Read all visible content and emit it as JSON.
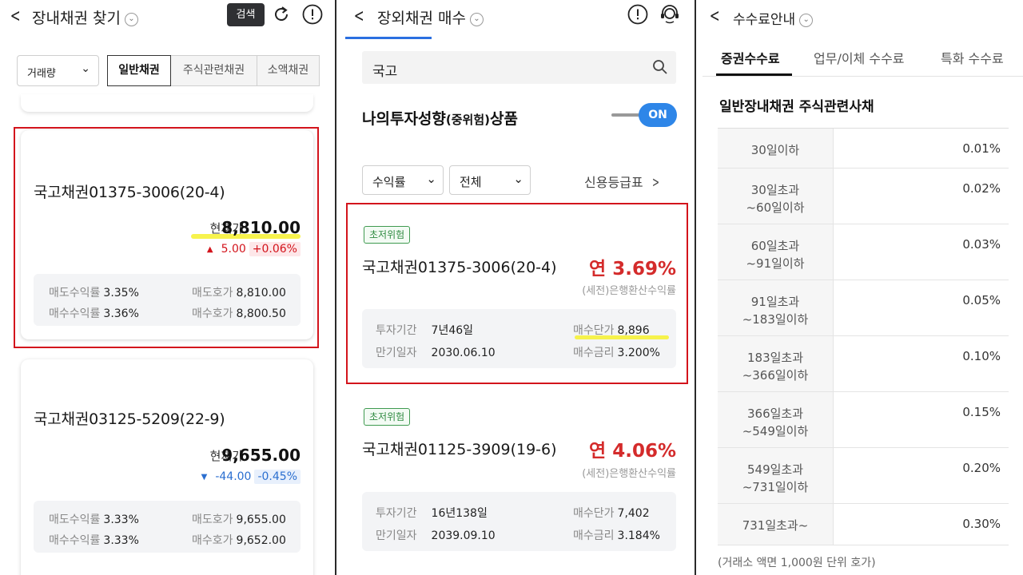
{
  "colors": {
    "accent_blue": "#2e86e8",
    "up_red": "#d3141c",
    "down_blue": "#2b6fd0",
    "risk_green": "#2e8a40",
    "rate_red": "#d42b2b"
  },
  "panel1": {
    "title": "장내채권 찾기",
    "search_label": "검색",
    "sort_select": "거래량",
    "segments": [
      "일반채권",
      "주식관련채권",
      "소액채권"
    ],
    "bonds": [
      {
        "name": "국고채권01375-3006(20-4)",
        "current_label": "현재가",
        "current_value": "8,810.00",
        "change": "5.00",
        "change_pct": "+0.06%",
        "direction": "up",
        "sell_yield_label": "매도수익률",
        "sell_yield": "3.35%",
        "buy_yield_label": "매수수익률",
        "buy_yield": "3.36%",
        "sell_quote_label": "매도호가",
        "sell_quote": "8,810.00",
        "buy_quote_label": "매수호가",
        "buy_quote": "8,800.50"
      },
      {
        "name": "국고채권03125-5209(22-9)",
        "current_label": "현재가",
        "current_value": "9,655.00",
        "change": "-44.00",
        "change_pct": "-0.45%",
        "direction": "down",
        "sell_yield_label": "매도수익률",
        "sell_yield": "3.33%",
        "buy_yield_label": "매수수익률",
        "buy_yield": "3.33%",
        "sell_quote_label": "매도호가",
        "sell_quote": "9,655.00",
        "buy_quote_label": "매수호가",
        "buy_quote": "9,652.00"
      }
    ]
  },
  "panel2": {
    "title": "장외채권 매수",
    "search_value": "국고",
    "pref_title_a": "나의투자성향",
    "pref_title_b": "(중위험)",
    "pref_title_c": "상품",
    "toggle_label": "ON",
    "filter_1": "수익률",
    "filter_2": "전체",
    "credit_link": "신용등급표",
    "bonds": [
      {
        "risk": "초저위험",
        "name": "국고채권01375-3006(20-4)",
        "rate": "연 3.69%",
        "rate_sub": "(세전)은행환산수익률",
        "term_label": "투자기간",
        "term": "7년46일",
        "maturity_label": "만기일자",
        "maturity": "2030.06.10",
        "unit_price_label": "매수단가",
        "unit_price": "8,896",
        "buy_rate_label": "매수금리",
        "buy_rate": "3.200%"
      },
      {
        "risk": "초저위험",
        "name": "국고채권01125-3909(19-6)",
        "rate": "연 4.06%",
        "rate_sub": "(세전)은행환산수익률",
        "term_label": "투자기간",
        "term": "16년138일",
        "maturity_label": "만기일자",
        "maturity": "2039.09.10",
        "unit_price_label": "매수단가",
        "unit_price": "7,402",
        "buy_rate_label": "매수금리",
        "buy_rate": "3.184%"
      }
    ]
  },
  "panel3": {
    "title": "수수료안내",
    "tabs": [
      "증권수수료",
      "업무/이체 수수료",
      "특화 수수료"
    ],
    "heading": "일반장내채권 주식관련사채",
    "rows": [
      {
        "period_1": "30일이하",
        "period_2": "",
        "rate": "0.01%"
      },
      {
        "period_1": "30일초과",
        "period_2": "~60일이하",
        "rate": "0.02%"
      },
      {
        "period_1": "60일초과",
        "period_2": "~91일이하",
        "rate": "0.03%"
      },
      {
        "period_1": "91일초과",
        "period_2": "~183일이하",
        "rate": "0.05%"
      },
      {
        "period_1": "183일초과",
        "period_2": "~366일이하",
        "rate": "0.10%"
      },
      {
        "period_1": "366일초과",
        "period_2": "~549일이하",
        "rate": "0.15%"
      },
      {
        "period_1": "549일초과",
        "period_2": "~731일이하",
        "rate": "0.20%"
      },
      {
        "period_1": "731일초과~",
        "period_2": "",
        "rate": "0.30%"
      }
    ],
    "note": "(거래소 액면 1,000원 단위 호가)"
  }
}
